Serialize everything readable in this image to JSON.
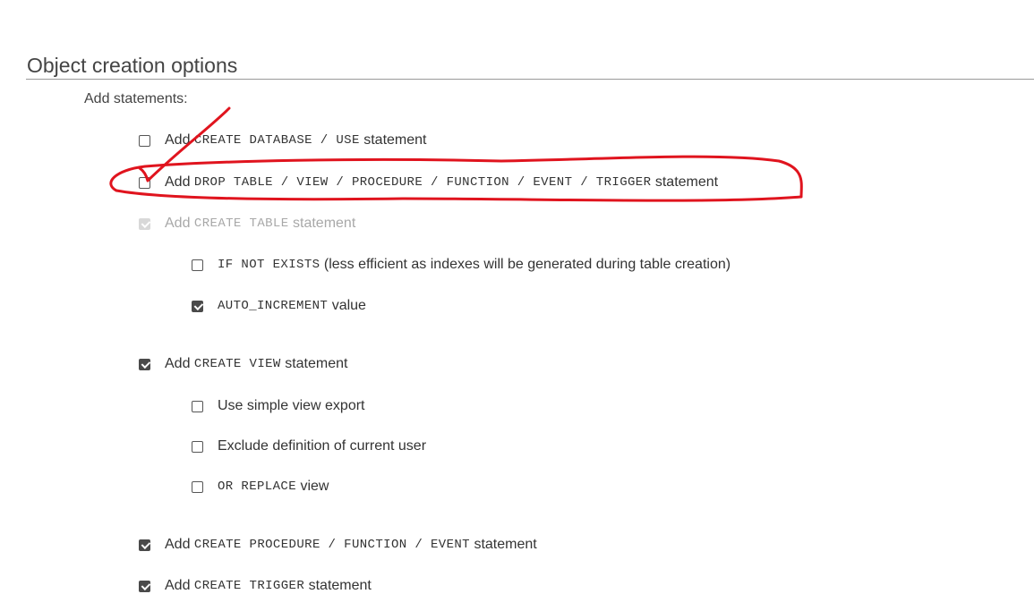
{
  "section": {
    "title": "Object creation options",
    "add_statements_label": "Add statements:"
  },
  "options": {
    "create_database": {
      "prefix": "Add",
      "code": "CREATE DATABASE / USE",
      "suffix": "statement",
      "checked": false
    },
    "drop_table": {
      "prefix": "Add",
      "code": "DROP TABLE / VIEW / PROCEDURE / FUNCTION / EVENT / TRIGGER",
      "suffix": "statement",
      "checked": false
    },
    "create_table": {
      "prefix": "Add",
      "code": "CREATE TABLE",
      "suffix": "statement",
      "checked": true,
      "disabled": true
    },
    "if_not_exists": {
      "code": "IF NOT EXISTS",
      "suffix": "(less efficient as indexes will be generated during table creation)",
      "checked": false
    },
    "auto_increment": {
      "code": "AUTO_INCREMENT",
      "suffix": "value",
      "checked": true
    },
    "create_view": {
      "prefix": "Add",
      "code": "CREATE VIEW",
      "suffix": "statement",
      "checked": true
    },
    "simple_view": {
      "label": "Use simple view export",
      "checked": false
    },
    "exclude_definer": {
      "label": "Exclude definition of current user",
      "checked": false
    },
    "or_replace": {
      "code": "OR REPLACE",
      "suffix": "view",
      "checked": false
    },
    "create_procedure": {
      "prefix": "Add",
      "code": "CREATE PROCEDURE / FUNCTION / EVENT",
      "suffix": "statement",
      "checked": true
    },
    "create_trigger": {
      "prefix": "Add",
      "code": "CREATE TRIGGER",
      "suffix": "statement",
      "checked": true
    }
  },
  "annotation_color": "#e0141e"
}
